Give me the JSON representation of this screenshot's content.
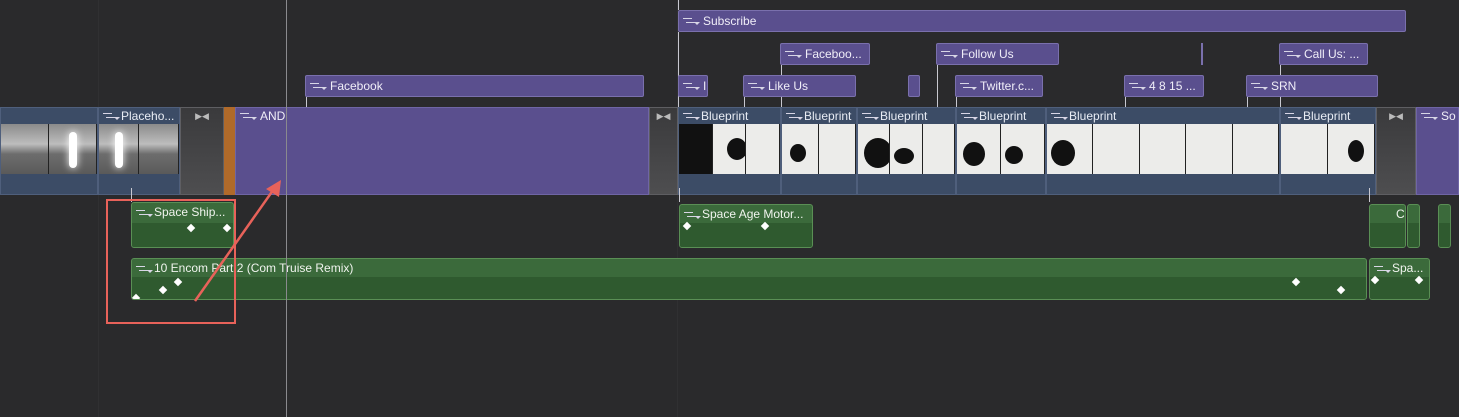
{
  "timeline": {
    "titles": {
      "subscribe": "Subscribe",
      "facebook_1": "Facebook",
      "facebook_2": "Faceboo...",
      "follow_us": "Follow Us",
      "call_us": "Call Us: ...",
      "like_us": "Like Us",
      "twitter": "Twitter.c...",
      "numbers": "4 8 15 ...",
      "srn": "SRN",
      "i_short": "I"
    },
    "video": {
      "placeholder": "Placeho...",
      "and": "AND",
      "blueprint": "Blueprint",
      "so": "So"
    },
    "audio": {
      "space_ship": "Space Ship...",
      "space_age": "Space Age Motor...",
      "encom": "10 Encom Part 2 (Com Truise Remix)",
      "spa": "Spa...",
      "c": "C"
    }
  },
  "colors": {
    "title_clip": "#5a4f8e",
    "video_clip": "#3c4c66",
    "audio_clip": "#3b6a3b",
    "annotation": "#e8625a"
  }
}
